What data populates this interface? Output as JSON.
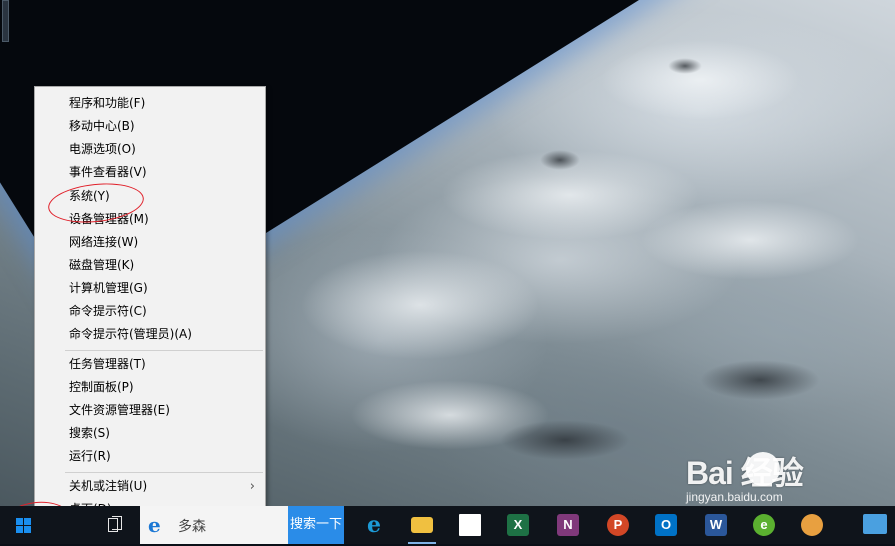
{
  "context_menu": {
    "group1": [
      {
        "label": "程序和功能(F)"
      },
      {
        "label": "移动中心(B)"
      },
      {
        "label": "电源选项(O)"
      },
      {
        "label": "事件查看器(V)"
      },
      {
        "label": "系统(Y)"
      },
      {
        "label": "设备管理器(M)"
      },
      {
        "label": "网络连接(W)"
      },
      {
        "label": "磁盘管理(K)"
      },
      {
        "label": "计算机管理(G)"
      },
      {
        "label": "命令提示符(C)"
      },
      {
        "label": "命令提示符(管理员)(A)"
      }
    ],
    "group2": [
      {
        "label": "任务管理器(T)"
      },
      {
        "label": "控制面板(P)"
      },
      {
        "label": "文件资源管理器(E)"
      },
      {
        "label": "搜索(S)"
      },
      {
        "label": "运行(R)"
      }
    ],
    "group3": [
      {
        "label": "关机或注销(U)",
        "has_submenu": true
      },
      {
        "label": "桌面(D)"
      }
    ],
    "submenu_arrow": "›"
  },
  "taskbar": {
    "search_text": "多森",
    "search_button_label": "搜索一下",
    "ie_glyph": "e",
    "apps": [
      {
        "name": "edge",
        "glyph": "e",
        "color": "#1c78d4"
      },
      {
        "name": "file-explorer",
        "glyph": "",
        "color": "#f0c040"
      },
      {
        "name": "store",
        "glyph": "",
        "color": "#ffffff"
      },
      {
        "name": "excel",
        "glyph": "X",
        "color": "#1e7145"
      },
      {
        "name": "onenote",
        "glyph": "N",
        "color": "#80397b"
      },
      {
        "name": "powerpoint",
        "glyph": "P",
        "color": "#d24726"
      },
      {
        "name": "outlook",
        "glyph": "O",
        "color": "#0072c6"
      },
      {
        "name": "word",
        "glyph": "W",
        "color": "#2b579a"
      },
      {
        "name": "browser",
        "glyph": "e",
        "color": "#5bb030"
      },
      {
        "name": "paint",
        "glyph": "",
        "color": "#e8a040"
      }
    ]
  },
  "watermark": {
    "logo_text": "Bai  经验",
    "url": "jingyan.baidu.com"
  }
}
